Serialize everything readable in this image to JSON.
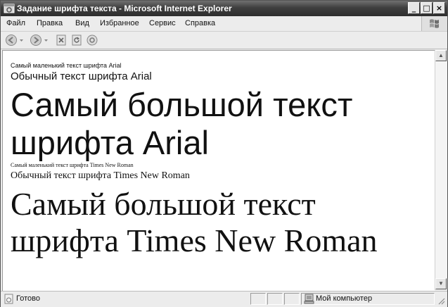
{
  "window": {
    "title": "Задание шрифта текста - Microsoft Internet Explorer",
    "minimize": "_",
    "maximize": "□",
    "close": "×"
  },
  "menu": {
    "items": [
      "Файл",
      "Правка",
      "Вид",
      "Избранное",
      "Сервис",
      "Справка"
    ]
  },
  "toolbar": {
    "icons": [
      "back-icon",
      "forward-icon",
      "stop-icon",
      "refresh-icon",
      "home-icon"
    ]
  },
  "content": {
    "lines": [
      "Самый маленький текст шрифта Arial",
      "Обычный текст шрифта Arial",
      "Самый большой текст",
      "шрифта Arial",
      "Самый маленький текст шрифта Times New Roman",
      "Обычный текст шрифта Times New Roman",
      "Самый большой текст",
      "шрифта Times New Roman"
    ]
  },
  "statusbar": {
    "status": "Готово",
    "zone": "Мой компьютер"
  }
}
